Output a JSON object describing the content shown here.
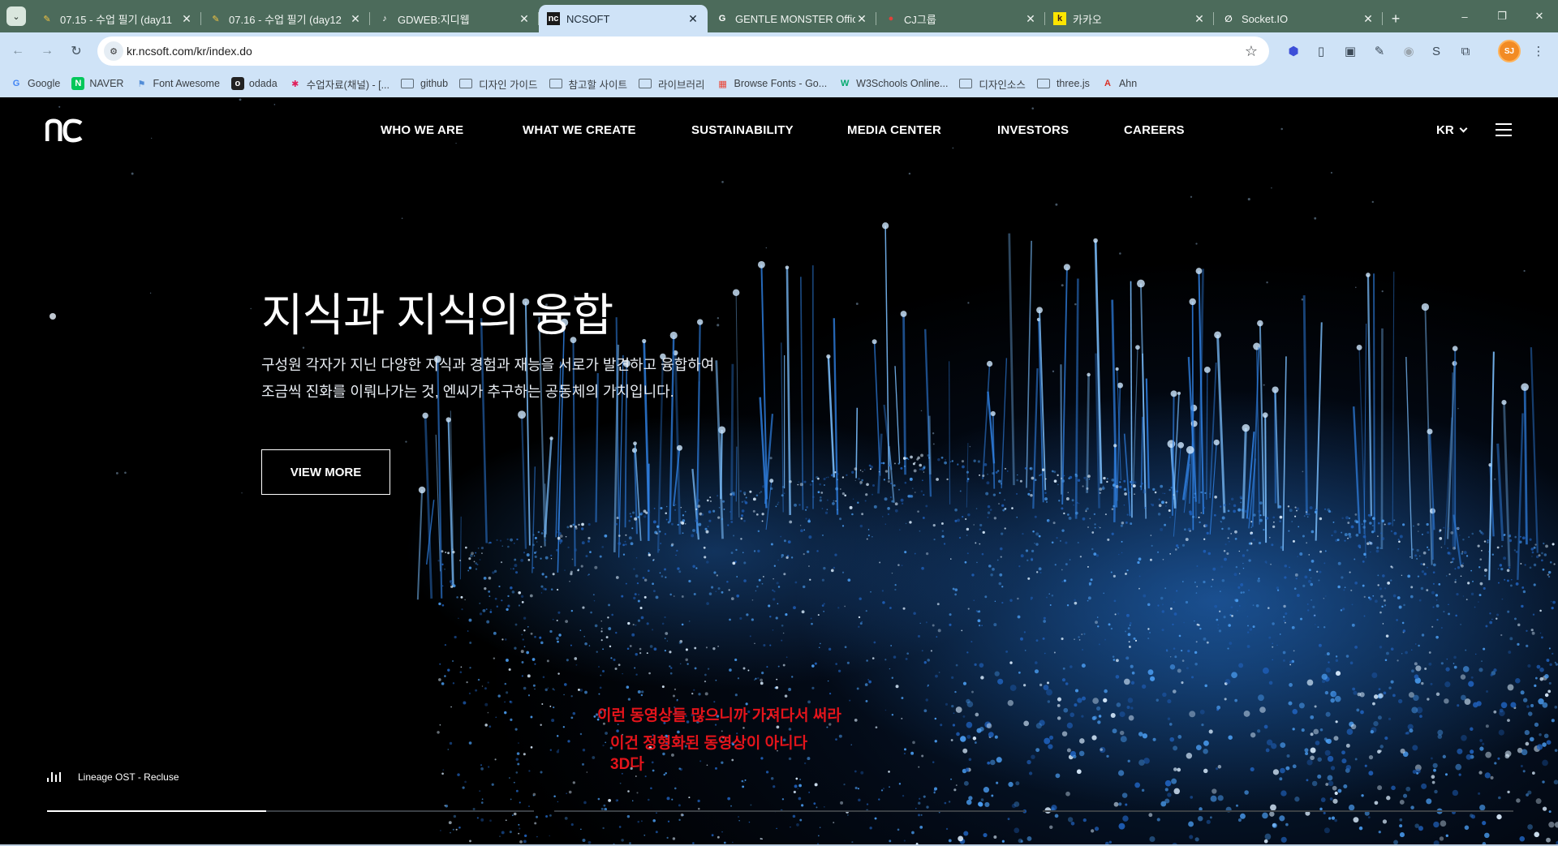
{
  "browser": {
    "tab_search_icon": "chevron-down",
    "tabs": [
      {
        "title": "07.15 - 수업 필기 (day11",
        "favicon": "pencil",
        "active": false
      },
      {
        "title": "07.16 - 수업 필기 (day12",
        "favicon": "pencil",
        "active": false
      },
      {
        "title": "GDWEB:지디웹",
        "favicon": "tiktok-like",
        "active": false
      },
      {
        "title": "NCSOFT",
        "favicon": "nc",
        "active": true
      },
      {
        "title": "GENTLE MONSTER Officia",
        "favicon": "G",
        "active": false
      },
      {
        "title": "CJ그룹",
        "favicon": "cj",
        "active": false
      },
      {
        "title": "카카오",
        "favicon": "k",
        "active": false
      },
      {
        "title": "Socket.IO",
        "favicon": "socket",
        "active": false
      }
    ],
    "new_tab": "+",
    "window_controls": {
      "minimize": "–",
      "restore": "❐",
      "close": "✕"
    },
    "url": "kr.ncsoft.com/kr/index.do",
    "profile_initials": "SJ",
    "bookmarks": [
      {
        "label": "Google",
        "type": "site",
        "icon": "G",
        "color": "#4285f4"
      },
      {
        "label": "NAVER",
        "type": "site",
        "icon": "N",
        "color": "#03c75a"
      },
      {
        "label": "Font Awesome",
        "type": "site",
        "icon": "⚑",
        "color": "#528dd7"
      },
      {
        "label": "odada",
        "type": "site",
        "icon": "o",
        "color": "#222222"
      },
      {
        "label": "수업자료(채널) - [...",
        "type": "site",
        "icon": "✱",
        "color": "#e01e5a"
      },
      {
        "label": "github",
        "type": "folder"
      },
      {
        "label": "디자인 가이드",
        "type": "folder"
      },
      {
        "label": "참고할 사이트",
        "type": "folder"
      },
      {
        "label": "라이브러리",
        "type": "folder"
      },
      {
        "label": "Browse Fonts - Go...",
        "type": "site",
        "icon": "▦",
        "color": "#ea4335"
      },
      {
        "label": "W3Schools Online...",
        "type": "site",
        "icon": "W",
        "color": "#04aa6d"
      },
      {
        "label": "디자인소스",
        "type": "folder"
      },
      {
        "label": "three.js",
        "type": "folder"
      },
      {
        "label": "Ahn",
        "type": "site",
        "icon": "A",
        "color": "#d93025"
      }
    ]
  },
  "site": {
    "nav": [
      "WHO WE ARE",
      "WHAT WE CREATE",
      "SUSTAINABILITY",
      "MEDIA CENTER",
      "INVESTORS",
      "CAREERS"
    ],
    "lang": "KR",
    "hero": {
      "title": "지식과 지식의 융합",
      "desc_line1": "구성원 각자가 지닌 다양한 지식과 경험과 재능을 서로가 발견하고 융합하여",
      "desc_line2": "조금씩 진화를 이뤄나가는 것, 엔씨가 추구하는 공동체의 가치입니다.",
      "button": "VIEW MORE"
    },
    "music_title": "Lineage OST - Recluse",
    "slide_progress": 0.45,
    "annotations": [
      "이런 동영상들 많으니까 가져다서 써라",
      "이건 정형화된 동영상이 아니다",
      "3D다"
    ]
  }
}
